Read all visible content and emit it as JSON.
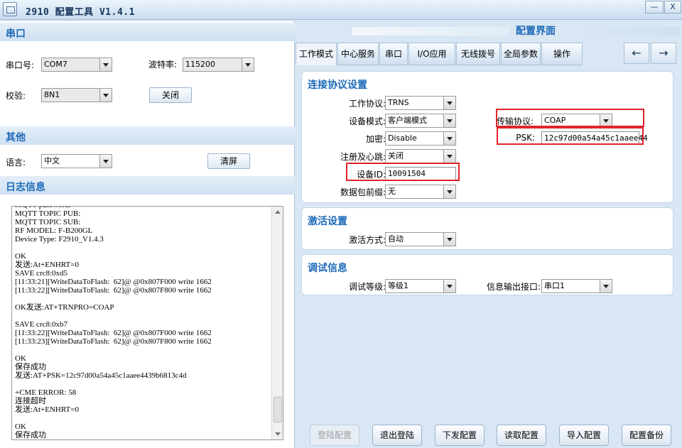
{
  "window": {
    "title": "2910 配置工具 V1.4.1",
    "min_label": "—",
    "close_label": "X"
  },
  "left": {
    "serial_section": "串口",
    "port_label": "串口号:",
    "port_value": "COM7",
    "baud_label": "波特率:",
    "baud_value": "115200",
    "parity_label": "校验:",
    "parity_value": "8N1",
    "close_button": "关闭",
    "other_section": "其他",
    "language_label": "语言:",
    "language_value": "中文",
    "clear_button": "清屏",
    "log_section": "日志信息",
    "log_text": "MQTT password:\nMQTT TOPIC PUB:\nMQTT TOPIC SUB:\nRF MODEL: F-B200GL\nDevice Type: F2910_V1.4.3\n\nOK\n发送:At+ENHRT=0\nSAVE crc8:0xd5\n[11:33:21][WriteDataToFlash:  62]@ @0x807F000 write 1662\n[11:33:22][WriteDataToFlash:  62]@ @0x807F800 write 1662\n\nOK发送:AT+TRNPRO=COAP\n\nSAVE crc8:0xb7\n[11:33:22][WriteDataToFlash:  62]@ @0x807F000 write 1662\n[11:33:23][WriteDataToFlash:  62]@ @0x807F800 write 1662\n\nOK\n保存成功\n发送:AT+PSK=12c97d00a54a45c1aaee4439b6813c4d\n\n+CME ERROR: 58\n连接超时\n发送:At+ENHRT=0\n\nOK\n保存成功"
  },
  "right": {
    "config_title": "配置界面",
    "tabs": [
      "工作模式",
      "中心服务",
      "串口",
      "I/O应用",
      "无线拨号",
      "全局参数",
      "操作"
    ],
    "nav_prev": "←",
    "nav_next": "→",
    "conn": {
      "title": "连接协议设置",
      "work_protocol_label": "工作协议:",
      "work_protocol_value": "TRNS",
      "device_mode_label": "设备模式:",
      "device_mode_value": "客户端模式",
      "encrypt_label": "加密:",
      "encrypt_value": "Disable",
      "register_label": "注册及心跳:",
      "register_value": "关闭",
      "device_id_label": "设备ID:",
      "device_id_value": "10091504",
      "prefix_label": "数据包前缀:",
      "prefix_value": "无",
      "transport_label": "传输协议:",
      "transport_value": "COAP",
      "psk_label": "PSK:",
      "psk_value": "12c97d00a54a45c1aaee44"
    },
    "activation": {
      "title": "激活设置",
      "mode_label": "激活方式:",
      "mode_value": "自动"
    },
    "debug": {
      "title": "调试信息",
      "level_label": "调试等级:",
      "level_value": "等级1",
      "output_label": "信息输出接口:",
      "output_value": "串口1"
    },
    "buttons": [
      "登陆配置",
      "退出登陆",
      "下发配置",
      "读取配置",
      "导入配置",
      "配置备份"
    ]
  },
  "colors": {
    "accent": "#1e6bb8",
    "highlight": "#e0242a"
  }
}
